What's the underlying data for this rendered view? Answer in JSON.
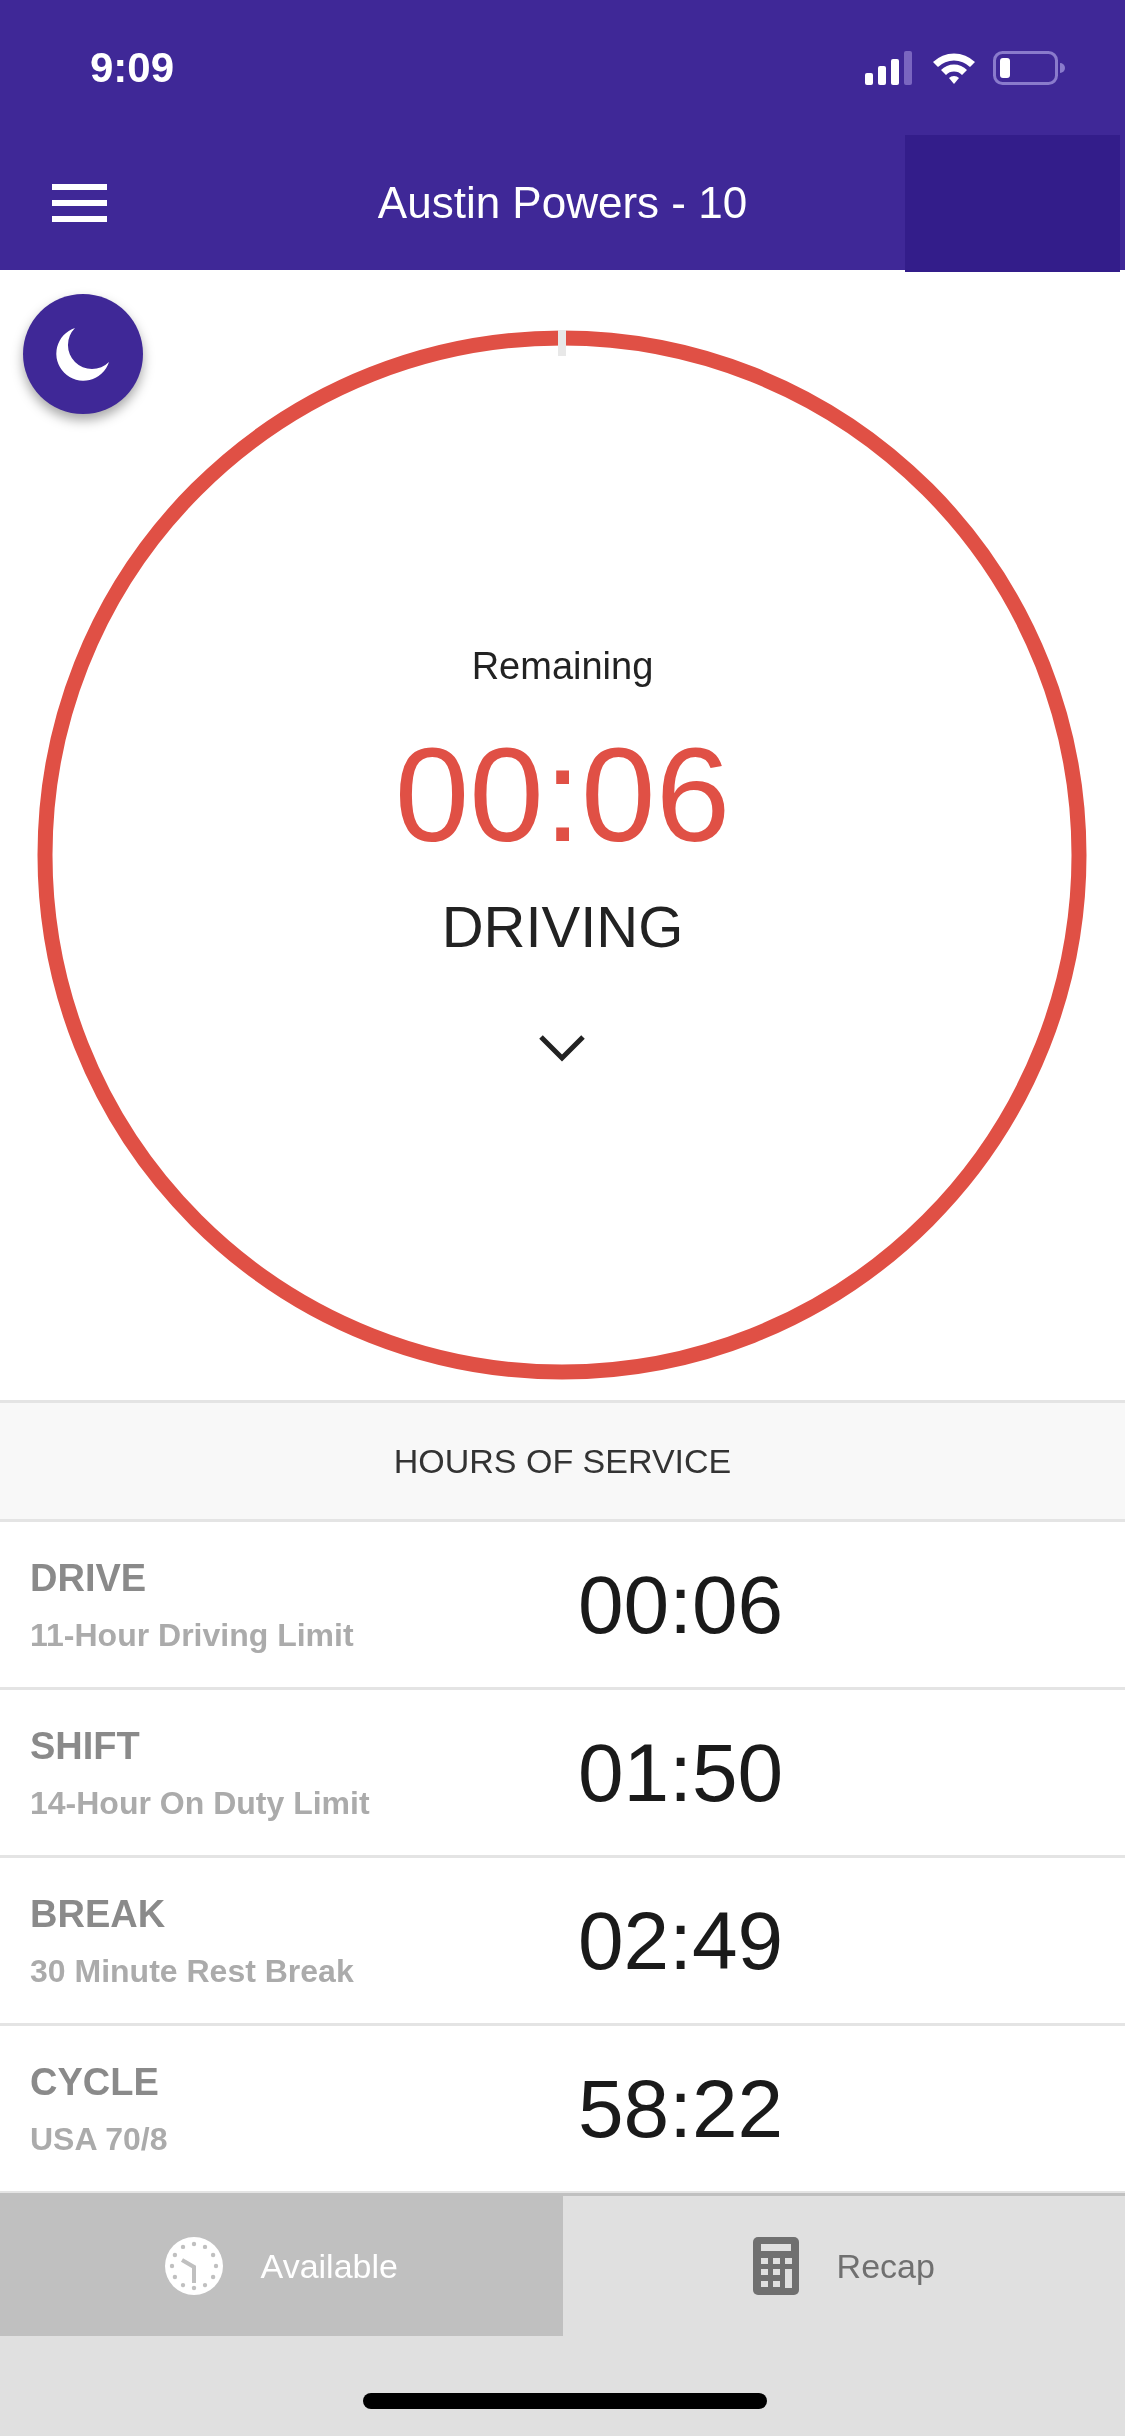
{
  "status_bar": {
    "time": "9:09"
  },
  "header": {
    "title": "Austin Powers - 10"
  },
  "timer": {
    "label": "Remaining",
    "value": "00:06",
    "status": "DRIVING"
  },
  "hours_of_service": {
    "title": "HOURS OF SERVICE",
    "rows": [
      {
        "name": "DRIVE",
        "description": "11-Hour Driving Limit",
        "value": "00:06"
      },
      {
        "name": "SHIFT",
        "description": "14-Hour On Duty Limit",
        "value": "01:50"
      },
      {
        "name": "BREAK",
        "description": "30 Minute Rest Break",
        "value": "02:49"
      },
      {
        "name": "CYCLE",
        "description": "USA 70/8",
        "value": "58:22"
      }
    ]
  },
  "tabs": [
    {
      "label": "Available",
      "kind": "clock",
      "selected": true
    },
    {
      "label": "Recap",
      "kind": "calculator",
      "selected": false
    }
  ]
}
